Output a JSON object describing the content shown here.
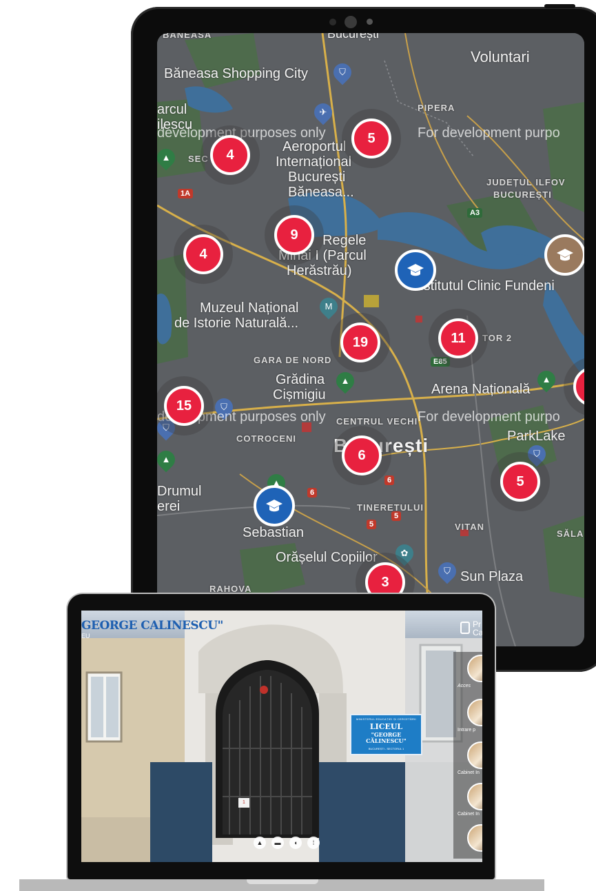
{
  "map": {
    "labels": {
      "baneasa_top": "BĂNEASA",
      "bucuresti_top": "București",
      "voluntari": "Voluntari",
      "shopping": "Băneasa Shopping City",
      "parcul": "arcul",
      "ilescu": "ilescu",
      "sec": "SEC",
      "airport1": "Aeroportul",
      "airport2": "Internațional",
      "airport3": "București",
      "airport4": "Băneasa...",
      "pipera": "PIPERA",
      "judet1": "JUDEȚUL ILFOV",
      "judet2": "BUCUREȘTI",
      "regele1": "Regele",
      "regele2": "Mihai I (Parcul",
      "regele3": "Herăstrău)",
      "fundeni": "Institutul Clinic Fundeni",
      "muzeul1": "Muzeul Național",
      "muzeul2": "de Istorie Naturală...",
      "gara": "GARA DE NORD",
      "gradina1": "Grădina",
      "gradina2": "Cișmigiu",
      "arena": "Arena Națională",
      "centrul": "CENTRUL VECHI",
      "cotroceni": "COTROCENI",
      "parklake": "ParkLake",
      "bucuresti_big": "București",
      "drumul1": "Drumul",
      "drumul2": "erei",
      "sebastian": "Sebastian",
      "tineretului": "TINERETULUI",
      "vitan": "VITAN",
      "sala": "SĂLA",
      "orasel": "Orășelul Copiilor",
      "sunplaza": "Sun Plaza",
      "rahova": "RAHOVA",
      "tor2": "TOR 2",
      "shield_a3": "A3",
      "shield_1a": "1A",
      "shield_e85": "E85",
      "shield_6a": "6",
      "shield_6b": "6",
      "shield_5a": "5",
      "shield_5b": "5"
    },
    "watermark": {
      "w1": "development purposes only",
      "w2": "For development purpo",
      "w3": "development purposes only",
      "w4": "For development purpo"
    },
    "clusters": {
      "c1": "4",
      "c2": "5",
      "c3": "9",
      "c4": "4",
      "c5": "19",
      "c6": "11",
      "c7": "15",
      "c8": "6",
      "c9": "5",
      "c10": "3"
    },
    "colors": {
      "cluster": "#e8213f",
      "school": "#1f63b7",
      "school_alt": "#9a7a5e"
    }
  },
  "tour": {
    "title": "GEORGE CALINESCU\"",
    "subtitle": "EU",
    "logo_line1": "Pr",
    "logo_line2": "Ca",
    "sign": {
      "line1": "MINISTERUL EDUCAȚIEI ȘI CERCETĂRII",
      "line2": "LICEUL",
      "line3": "\"GEORGE CĂLINESCU\"",
      "line4": "BUCUREȘTI - SECTORUL 1"
    },
    "door_sign": "1",
    "thumbnails": [
      {
        "label": "Acces"
      },
      {
        "label": "Intrare p"
      },
      {
        "label": "Cabinet In"
      },
      {
        "label": "Cabinet In"
      },
      {
        "label": ""
      }
    ],
    "controls": [
      "image-icon",
      "screen-icon",
      "volume-icon",
      "grid-icon"
    ]
  }
}
